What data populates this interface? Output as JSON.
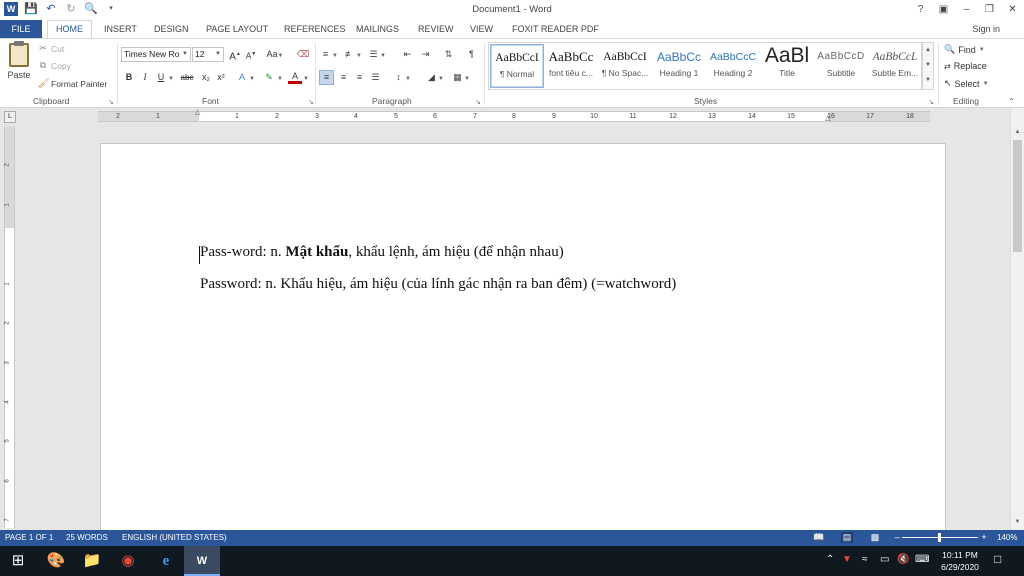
{
  "window": {
    "title": "Document1 - Word",
    "help": "?",
    "sign_in": "Sign in"
  },
  "tabs": [
    "FILE",
    "HOME",
    "INSERT",
    "DESIGN",
    "PAGE LAYOUT",
    "REFERENCES",
    "MAILINGS",
    "REVIEW",
    "VIEW",
    "FOXIT READER PDF"
  ],
  "clipboard": {
    "paste": "Paste",
    "cut": "Cut",
    "copy": "Copy",
    "format_painter": "Format Painter",
    "label": "Clipboard"
  },
  "font": {
    "family": "Times New Ro",
    "size": "12",
    "label": "Font",
    "bold": "B",
    "italic": "I",
    "underline": "U",
    "strike": "abc",
    "subscript": "x₂",
    "superscript": "x²",
    "grow": "A",
    "shrink": "A",
    "case": "Aa",
    "color_a": "A",
    "effects_a": "A"
  },
  "paragraph": {
    "label": "Paragraph",
    "pilcrow": "¶"
  },
  "styles": {
    "label": "Styles",
    "items": [
      {
        "sample": "AaBbCcI",
        "name": "¶ Normal"
      },
      {
        "sample": "AaBbCc",
        "name": "font tiêu c..."
      },
      {
        "sample": "AaBbCcI",
        "name": "¶ No Spac..."
      },
      {
        "sample": "AaBbCc",
        "name": "Heading 1"
      },
      {
        "sample": "AaBbCcC",
        "name": "Heading 2"
      },
      {
        "sample": "AaBl",
        "name": "Title"
      },
      {
        "sample": "AaBbCcD",
        "name": "Subtitle"
      },
      {
        "sample": "AaBbCcL",
        "name": "Subtle Em..."
      }
    ]
  },
  "editing": {
    "label": "Editing",
    "find": "Find",
    "replace": "Replace",
    "select": "Select"
  },
  "ruler": {
    "tab_marker": "L",
    "h_numbers": [
      "2",
      "1",
      "1",
      "2",
      "3",
      "4",
      "5",
      "6",
      "7",
      "8",
      "9",
      "10",
      "11",
      "12",
      "13",
      "14",
      "15",
      "16",
      "17",
      "18"
    ],
    "v_numbers": [
      "2",
      "1",
      "1",
      "2",
      "3",
      "4",
      "5",
      "6",
      "7"
    ]
  },
  "document": {
    "line1": {
      "before": "Pass-word: n. ",
      "bold": "Mật khẩu",
      "after": ", khẩu lệnh, ám hiệu (để nhận nhau)"
    },
    "line2": "Password: n. Khẩu hiệu, ám hiệu (của lính gác nhận ra ban đêm) (=watchword)"
  },
  "status": {
    "page": "PAGE 1 OF 1",
    "words": "25 WORDS",
    "language": "ENGLISH (UNITED STATES)",
    "zoom": "140%"
  },
  "taskbar": {
    "time": "10:11 PM",
    "date": "6/29/2020"
  },
  "colors": {
    "accent": "#2b579a",
    "taskbar": "#101820"
  }
}
